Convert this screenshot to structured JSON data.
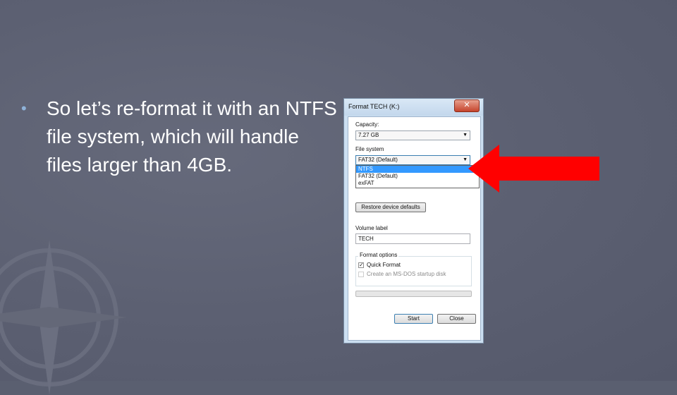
{
  "slide": {
    "bullet_glyph": "•",
    "bullet_text": "So let’s re-format it with an NTFS file system, which will handle files larger than 4GB."
  },
  "dialog": {
    "title": "Format TECH (K:)",
    "close_glyph": "✕",
    "capacity_label": "Capacity:",
    "capacity_value": "7.27 GB",
    "file_system_label": "File system",
    "file_system_value": "FAT32 (Default)",
    "file_system_options": [
      "NTFS",
      "FAT32 (Default)",
      "exFAT"
    ],
    "selected_option": "NTFS",
    "restore_button": "Restore device defaults",
    "volume_label_label": "Volume label",
    "volume_label_value": "TECH",
    "format_options_label": "Format options",
    "quick_format_label": "Quick Format",
    "quick_format_checked": true,
    "msdos_label": "Create an MS-DOS startup disk",
    "msdos_checked": false,
    "progress": 0,
    "start_button": "Start",
    "close_button": "Close"
  },
  "colors": {
    "background": "#5a5f70",
    "arrow": "#ff0000",
    "selection": "#3399ff"
  }
}
